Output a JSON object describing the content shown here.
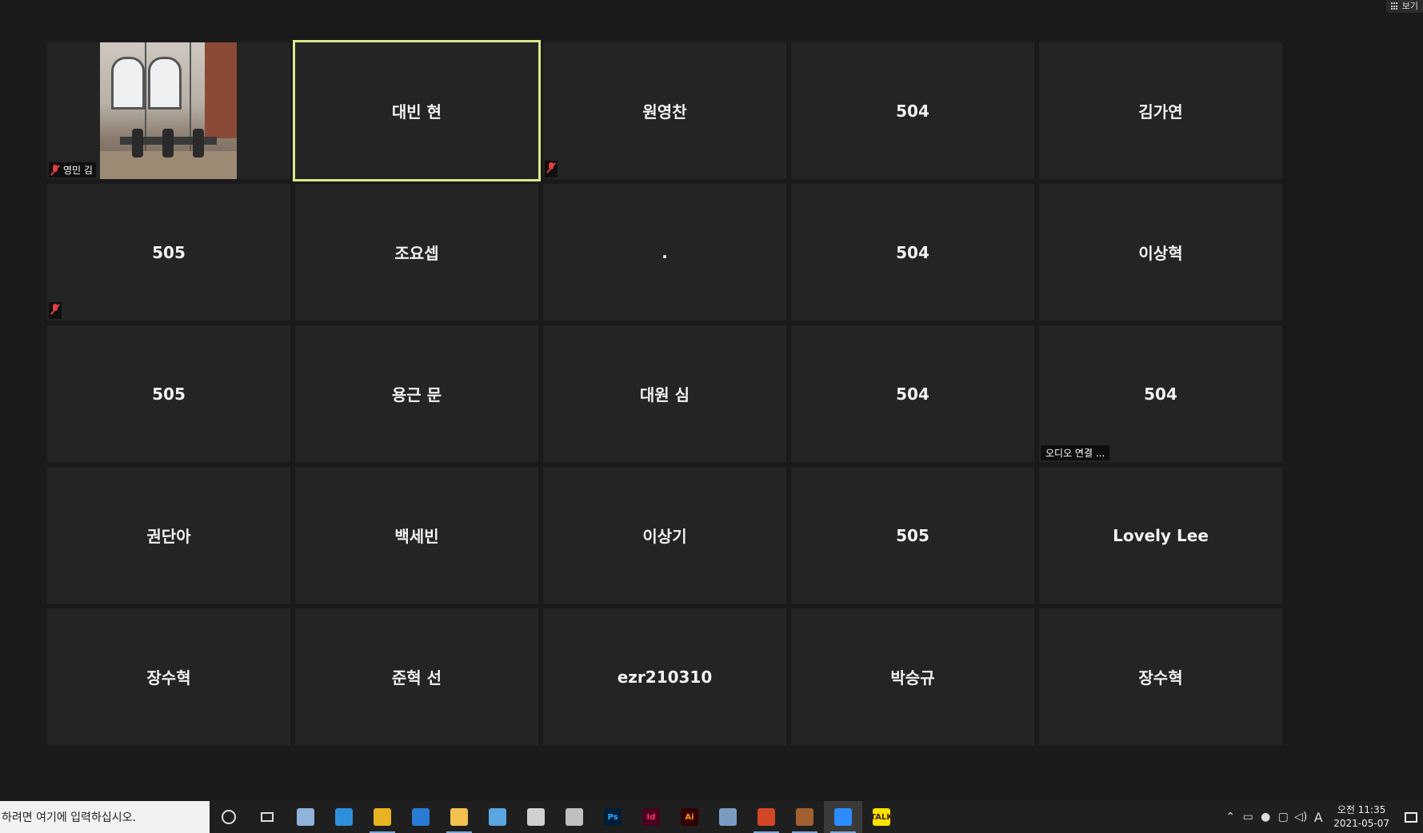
{
  "view_button": {
    "label": "보기"
  },
  "tiles": [
    {
      "name": "",
      "tag": "영민 김",
      "muted": true,
      "video": true
    },
    {
      "name": "대빈 현",
      "speaking": true
    },
    {
      "name": "원영찬",
      "muted_only": true
    },
    {
      "name": "504"
    },
    {
      "name": "김가연"
    },
    {
      "name": "505",
      "muted_only": true
    },
    {
      "name": "조요셉"
    },
    {
      "name": "."
    },
    {
      "name": "504"
    },
    {
      "name": "이상혁"
    },
    {
      "name": "505"
    },
    {
      "name": "용근 문"
    },
    {
      "name": "대원 심"
    },
    {
      "name": "504"
    },
    {
      "name": "504",
      "audio_tag": "오디오 연결 ..."
    },
    {
      "name": "권단아"
    },
    {
      "name": "백세빈"
    },
    {
      "name": "이상기"
    },
    {
      "name": "505"
    },
    {
      "name": "Lovely Lee"
    },
    {
      "name": "장수혁"
    },
    {
      "name": "준혁 선"
    },
    {
      "name": "ezr210310"
    },
    {
      "name": "박승규"
    },
    {
      "name": "장수혁"
    }
  ],
  "taskbar": {
    "search_placeholder": "하려면 여기에 입력하십시오.",
    "apps": [
      {
        "name": "cortana-icon"
      },
      {
        "name": "task-view-icon"
      },
      {
        "name": "notepad-icon",
        "color": "#8fb3d9"
      },
      {
        "name": "edge-icon",
        "color": "#2f8fdc"
      },
      {
        "name": "chrome-icon",
        "color": "#e8b323",
        "running": true
      },
      {
        "name": "ie-icon",
        "color": "#2a7bd3"
      },
      {
        "name": "file-explorer-icon",
        "color": "#f2c14e",
        "running": true
      },
      {
        "name": "mail-icon",
        "color": "#5aa6e0"
      },
      {
        "name": "paint-icon",
        "color": "#d0d0d0"
      },
      {
        "name": "paint3d-icon",
        "color": "#c0c0c0"
      },
      {
        "name": "photoshop-icon",
        "label": "Ps",
        "color": "#31a8ff",
        "bg": "#001e36"
      },
      {
        "name": "indesign-icon",
        "label": "Id",
        "color": "#ff3366",
        "bg": "#49021f"
      },
      {
        "name": "illustrator-icon",
        "label": "Ai",
        "color": "#ff9a00",
        "bg": "#330000"
      },
      {
        "name": "calculator-icon",
        "color": "#7a9cc0"
      },
      {
        "name": "powerpoint-icon",
        "color": "#d24726",
        "running": true
      },
      {
        "name": "game-icon",
        "color": "#a06030",
        "running": true
      },
      {
        "name": "zoom-icon",
        "color": "#2d8cff",
        "active": true,
        "running": true
      },
      {
        "name": "kakaotalk-icon",
        "label": "TALK",
        "color": "#3a1d1d",
        "bg": "#fae100"
      }
    ],
    "clock": {
      "ampm_time": "오전 11:35",
      "date": "2021-05-07"
    },
    "ime_label": "A"
  }
}
